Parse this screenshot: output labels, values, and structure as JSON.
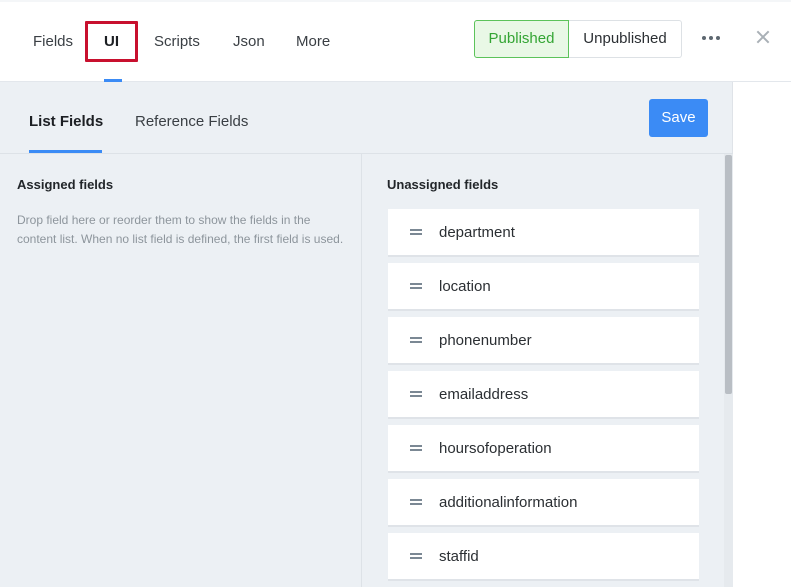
{
  "header": {
    "tabs": [
      {
        "label": "Fields"
      },
      {
        "label": "UI"
      },
      {
        "label": "Scripts"
      },
      {
        "label": "Json"
      },
      {
        "label": "More"
      }
    ],
    "active_tab": "UI",
    "status": {
      "published_label": "Published",
      "unpublished_label": "Unpublished",
      "active": "Published"
    },
    "more_icon": "more-horizontal-icon",
    "close_icon": "close-icon"
  },
  "subheader": {
    "tabs": [
      {
        "label": "List Fields"
      },
      {
        "label": "Reference Fields"
      }
    ],
    "active_tab": "List Fields",
    "save_label": "Save"
  },
  "assigned": {
    "title": "Assigned fields",
    "hint": "Drop field here or reorder them to show the fields in the content list. When no list field is defined, the first field is used."
  },
  "unassigned": {
    "title": "Unassigned fields",
    "items": [
      {
        "label": "department"
      },
      {
        "label": "location"
      },
      {
        "label": "phonenumber"
      },
      {
        "label": "emailaddress"
      },
      {
        "label": "hoursofoperation"
      },
      {
        "label": "additionalinformation"
      },
      {
        "label": "staffid"
      }
    ]
  },
  "colors": {
    "accent": "#3b8bf5",
    "published_bg": "#e9f8e6",
    "published_border": "#5cc35a",
    "highlight_box": "#c8102e",
    "panel_bg": "#ecf0f4"
  }
}
